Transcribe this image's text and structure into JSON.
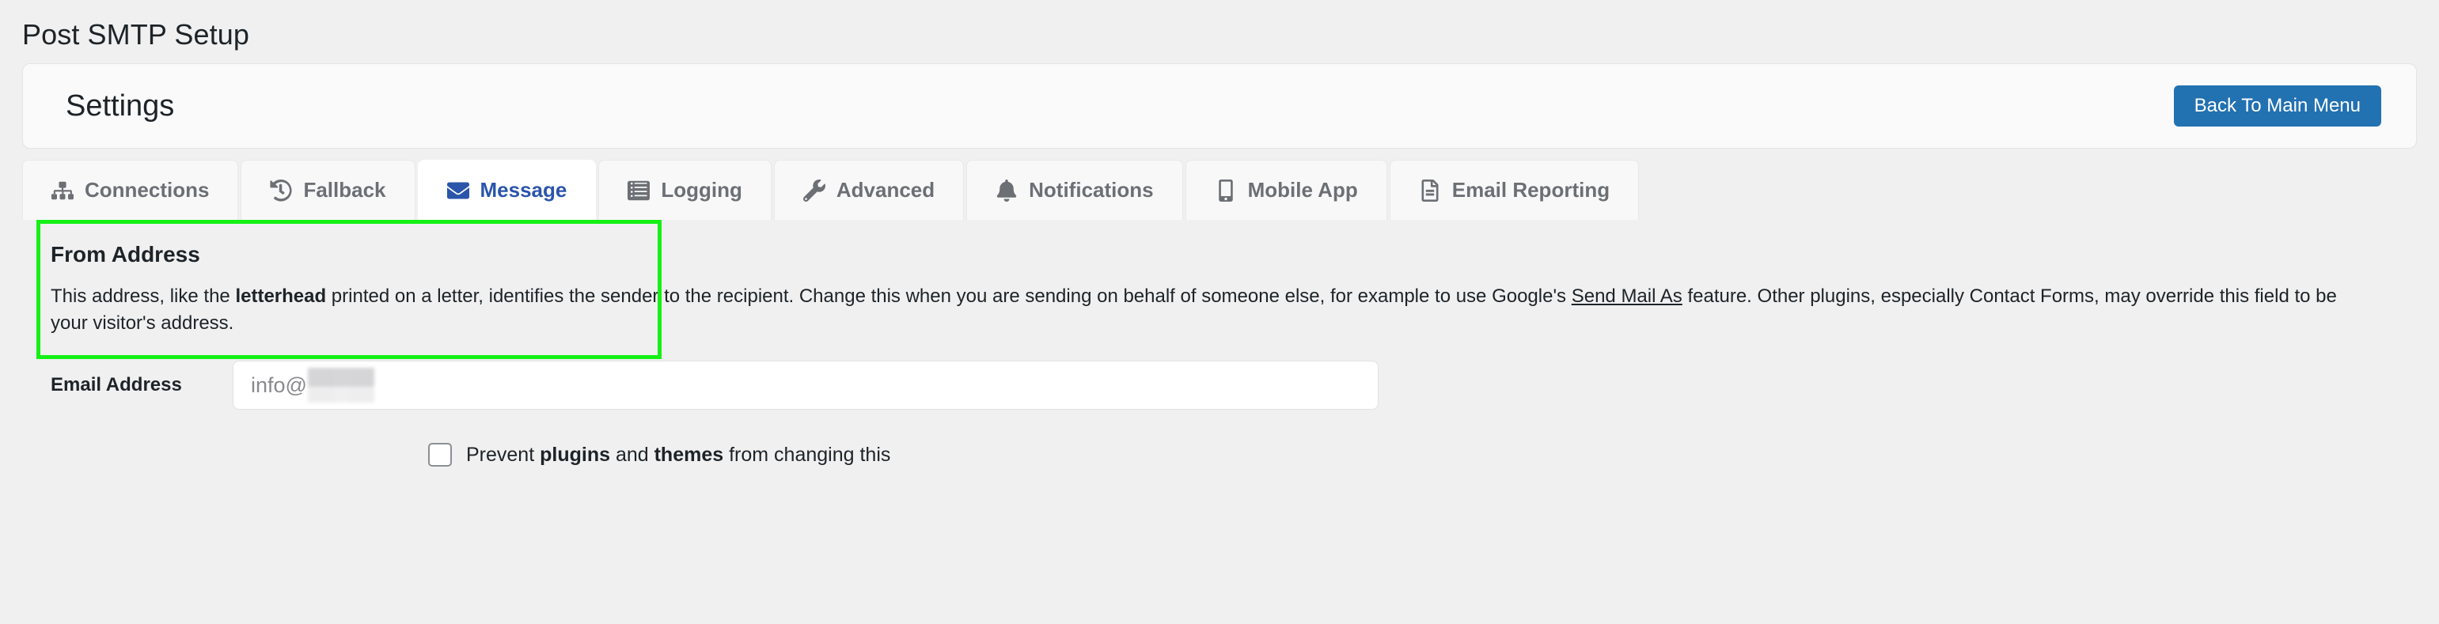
{
  "page": {
    "title": "Post SMTP Setup"
  },
  "header": {
    "title": "Settings",
    "back_button_label": "Back To Main Menu",
    "accent_color": "#2271b1"
  },
  "tabs": [
    {
      "label": "Connections",
      "icon": "sitemap-icon",
      "active": false
    },
    {
      "label": "Fallback",
      "icon": "history-icon",
      "active": false
    },
    {
      "label": "Message",
      "icon": "envelope-icon",
      "active": true
    },
    {
      "label": "Logging",
      "icon": "list-icon",
      "active": false
    },
    {
      "label": "Advanced",
      "icon": "wrench-icon",
      "active": false
    },
    {
      "label": "Notifications",
      "icon": "bell-icon",
      "active": false
    },
    {
      "label": "Mobile App",
      "icon": "mobile-icon",
      "active": false
    },
    {
      "label": "Email Reporting",
      "icon": "document-icon",
      "active": false
    }
  ],
  "from_address": {
    "section_title": "From Address",
    "description": {
      "part1": "This address, like the ",
      "bold1": "letterhead",
      "part2": " printed on a letter, identifies the sender to the recipient. Change this when you are sending on behalf of someone else, for example to use Google's ",
      "link": "Send Mail As",
      "part3": " feature. Other plugins, especially Contact Forms, may override this field to be your visitor's address."
    },
    "field_label": "Email Address",
    "field_value_visible": "info@",
    "field_value_redacted": true,
    "highlight_color": "#15f015"
  },
  "prevent_option": {
    "checked": false,
    "text_part1": "Prevent ",
    "bold1": "plugins",
    "text_part2": " and ",
    "bold2": "themes",
    "text_part3": " from changing this"
  }
}
